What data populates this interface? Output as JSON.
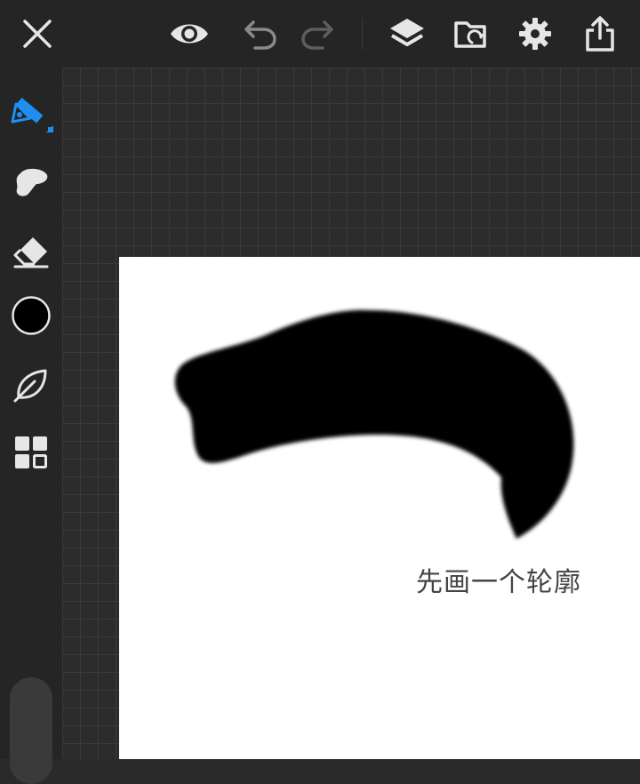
{
  "colors": {
    "toolbar_bg": "#252525",
    "grid_bg": "#2c2c2c",
    "grid_line": "#3a3a3a",
    "icon": "#e6e6e6",
    "icon_dim": "#8a8a8a",
    "accent": "#1e8ff0",
    "paper": "#ffffff",
    "ink": "#000000"
  },
  "toolbar": {
    "icons": [
      "close-icon",
      "eye-icon",
      "undo-icon",
      "redo-icon",
      "layers-icon",
      "folder-sync-icon",
      "gear-icon",
      "share-icon"
    ]
  },
  "sidebar": {
    "tools": [
      "pencil-icon",
      "smudge-icon",
      "eraser-icon",
      "color-swatch",
      "leaf-icon",
      "grid-menu-icon"
    ],
    "active_tool": "pencil-icon",
    "current_color": "#000000"
  },
  "canvas": {
    "caption": "先画一个轮廓"
  }
}
